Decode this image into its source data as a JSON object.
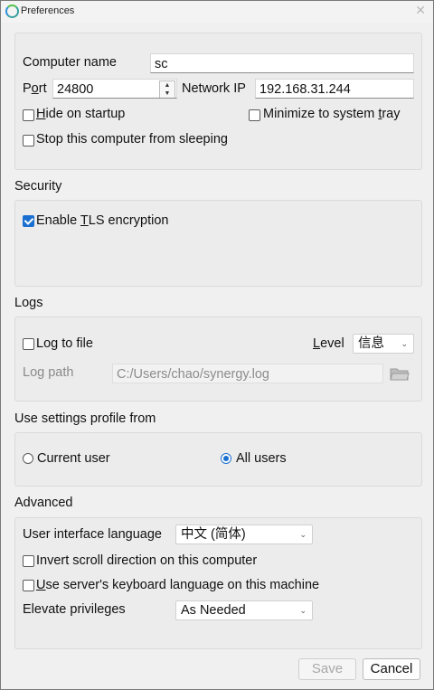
{
  "window": {
    "title": "Preferences"
  },
  "general": {
    "computer_name_label": "Computer name",
    "computer_name_value": "sc",
    "port_label_prefix": "P",
    "port_label_accel": "o",
    "port_label_suffix": "rt",
    "port_value": "24800",
    "network_ip_label": "Network IP",
    "network_ip_value": "192.168.31.244",
    "hide_on_startup_accel": "H",
    "hide_on_startup_rest": "ide on startup",
    "hide_on_startup_checked": false,
    "minimize_tray_prefix": "Minimize to system ",
    "minimize_tray_accel": "t",
    "minimize_tray_suffix": "ray",
    "minimize_tray_checked": false,
    "stop_sleeping_label": "Stop this computer from sleeping",
    "stop_sleeping_checked": false
  },
  "security": {
    "section_label": "Security",
    "tls_prefix": "Enable ",
    "tls_accel": "T",
    "tls_suffix": "LS encryption",
    "tls_checked": true
  },
  "logs": {
    "section_label": "Logs",
    "log_to_file_label": "Log to file",
    "log_to_file_checked": false,
    "level_accel": "L",
    "level_rest": "evel",
    "level_value": "信息",
    "log_path_label": "Log path",
    "log_path_value": "C:/Users/chao/synergy.log"
  },
  "profile": {
    "section_label": "Use settings profile from",
    "current_user_label": "Current user",
    "all_users_label": "All users",
    "selected": "All users"
  },
  "advanced": {
    "section_label": "Advanced",
    "ui_language_label": "User interface language",
    "ui_language_value": "中文 (简体)",
    "invert_scroll_label": "Invert scroll direction on this computer",
    "invert_scroll_checked": false,
    "server_keyboard_accel": "U",
    "server_keyboard_rest": "se server's keyboard language on this machine",
    "server_keyboard_checked": false,
    "elevate_label": "Elevate privileges",
    "elevate_value": "As Needed"
  },
  "buttons": {
    "save": "Save",
    "cancel": "Cancel"
  },
  "colors": {
    "accent": "#1a6fd1",
    "window_bg": "#f0f0f0",
    "group_bg": "#ececec"
  }
}
